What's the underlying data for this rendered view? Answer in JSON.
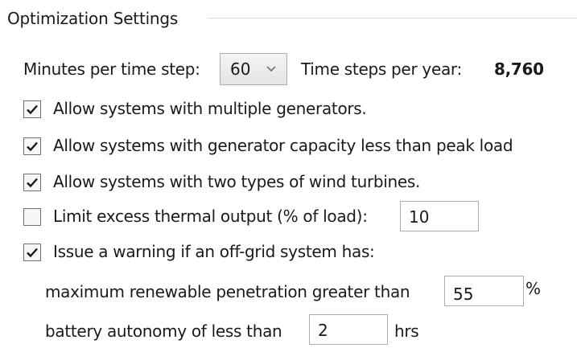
{
  "group": {
    "title": "Optimization Settings"
  },
  "time_step": {
    "label": "Minutes per time step:",
    "selected": "60",
    "steps_label": "Time steps per year:",
    "steps_value": "8,760"
  },
  "options": [
    {
      "label": "Allow systems with multiple generators.",
      "checked": true
    },
    {
      "label": "Allow systems with generator capacity less than peak load",
      "checked": true
    },
    {
      "label": "Allow systems with two types of wind turbines.",
      "checked": true
    },
    {
      "label": "Limit excess thermal output (% of load):",
      "checked": false,
      "value": "10"
    },
    {
      "label": "Issue a warning if an off-grid system has:",
      "checked": true
    }
  ],
  "warnings": {
    "renewable_label": "maximum renewable penetration greater than",
    "renewable_value": "55",
    "renewable_unit": "%",
    "autonomy_label": "battery autonomy of less than",
    "autonomy_value": "2",
    "autonomy_unit": "hrs"
  },
  "colors": {
    "check_mark": "#1a1a1a",
    "border": "#abadb3",
    "group_line": "#d5dbe0"
  }
}
